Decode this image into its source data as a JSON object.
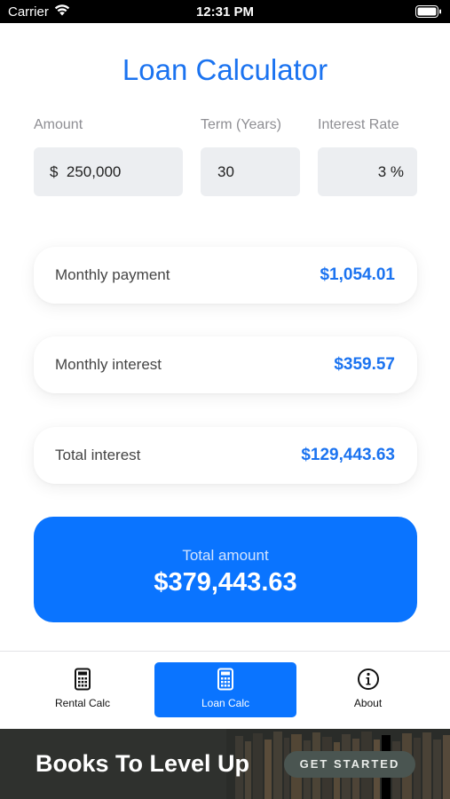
{
  "status_bar": {
    "carrier": "Carrier",
    "time": "12:31 PM"
  },
  "page": {
    "title": "Loan Calculator"
  },
  "inputs": {
    "amount": {
      "label": "Amount",
      "value": "$  250,000"
    },
    "term": {
      "label": "Term (Years)",
      "value": "30"
    },
    "rate": {
      "label": "Interest Rate",
      "value": "3 %"
    }
  },
  "results": [
    {
      "label": "Monthly payment",
      "value": "$1,054.01"
    },
    {
      "label": "Monthly interest",
      "value": "$359.57"
    },
    {
      "label": "Total interest",
      "value": "$129,443.63"
    }
  ],
  "total": {
    "label": "Total amount",
    "value": "$379,443.63"
  },
  "tabs": [
    {
      "label": "Rental Calc",
      "icon": "calculator-icon",
      "active": false
    },
    {
      "label": "Loan Calc",
      "icon": "calculator-icon",
      "active": true
    },
    {
      "label": "About",
      "icon": "info-icon",
      "active": false
    }
  ],
  "ad_banner": {
    "headline": "Books To Level Up",
    "cta": "GET STARTED"
  },
  "colors": {
    "accent": "#0a74ff",
    "title": "#1b73f0",
    "field_bg": "#eceef1"
  }
}
